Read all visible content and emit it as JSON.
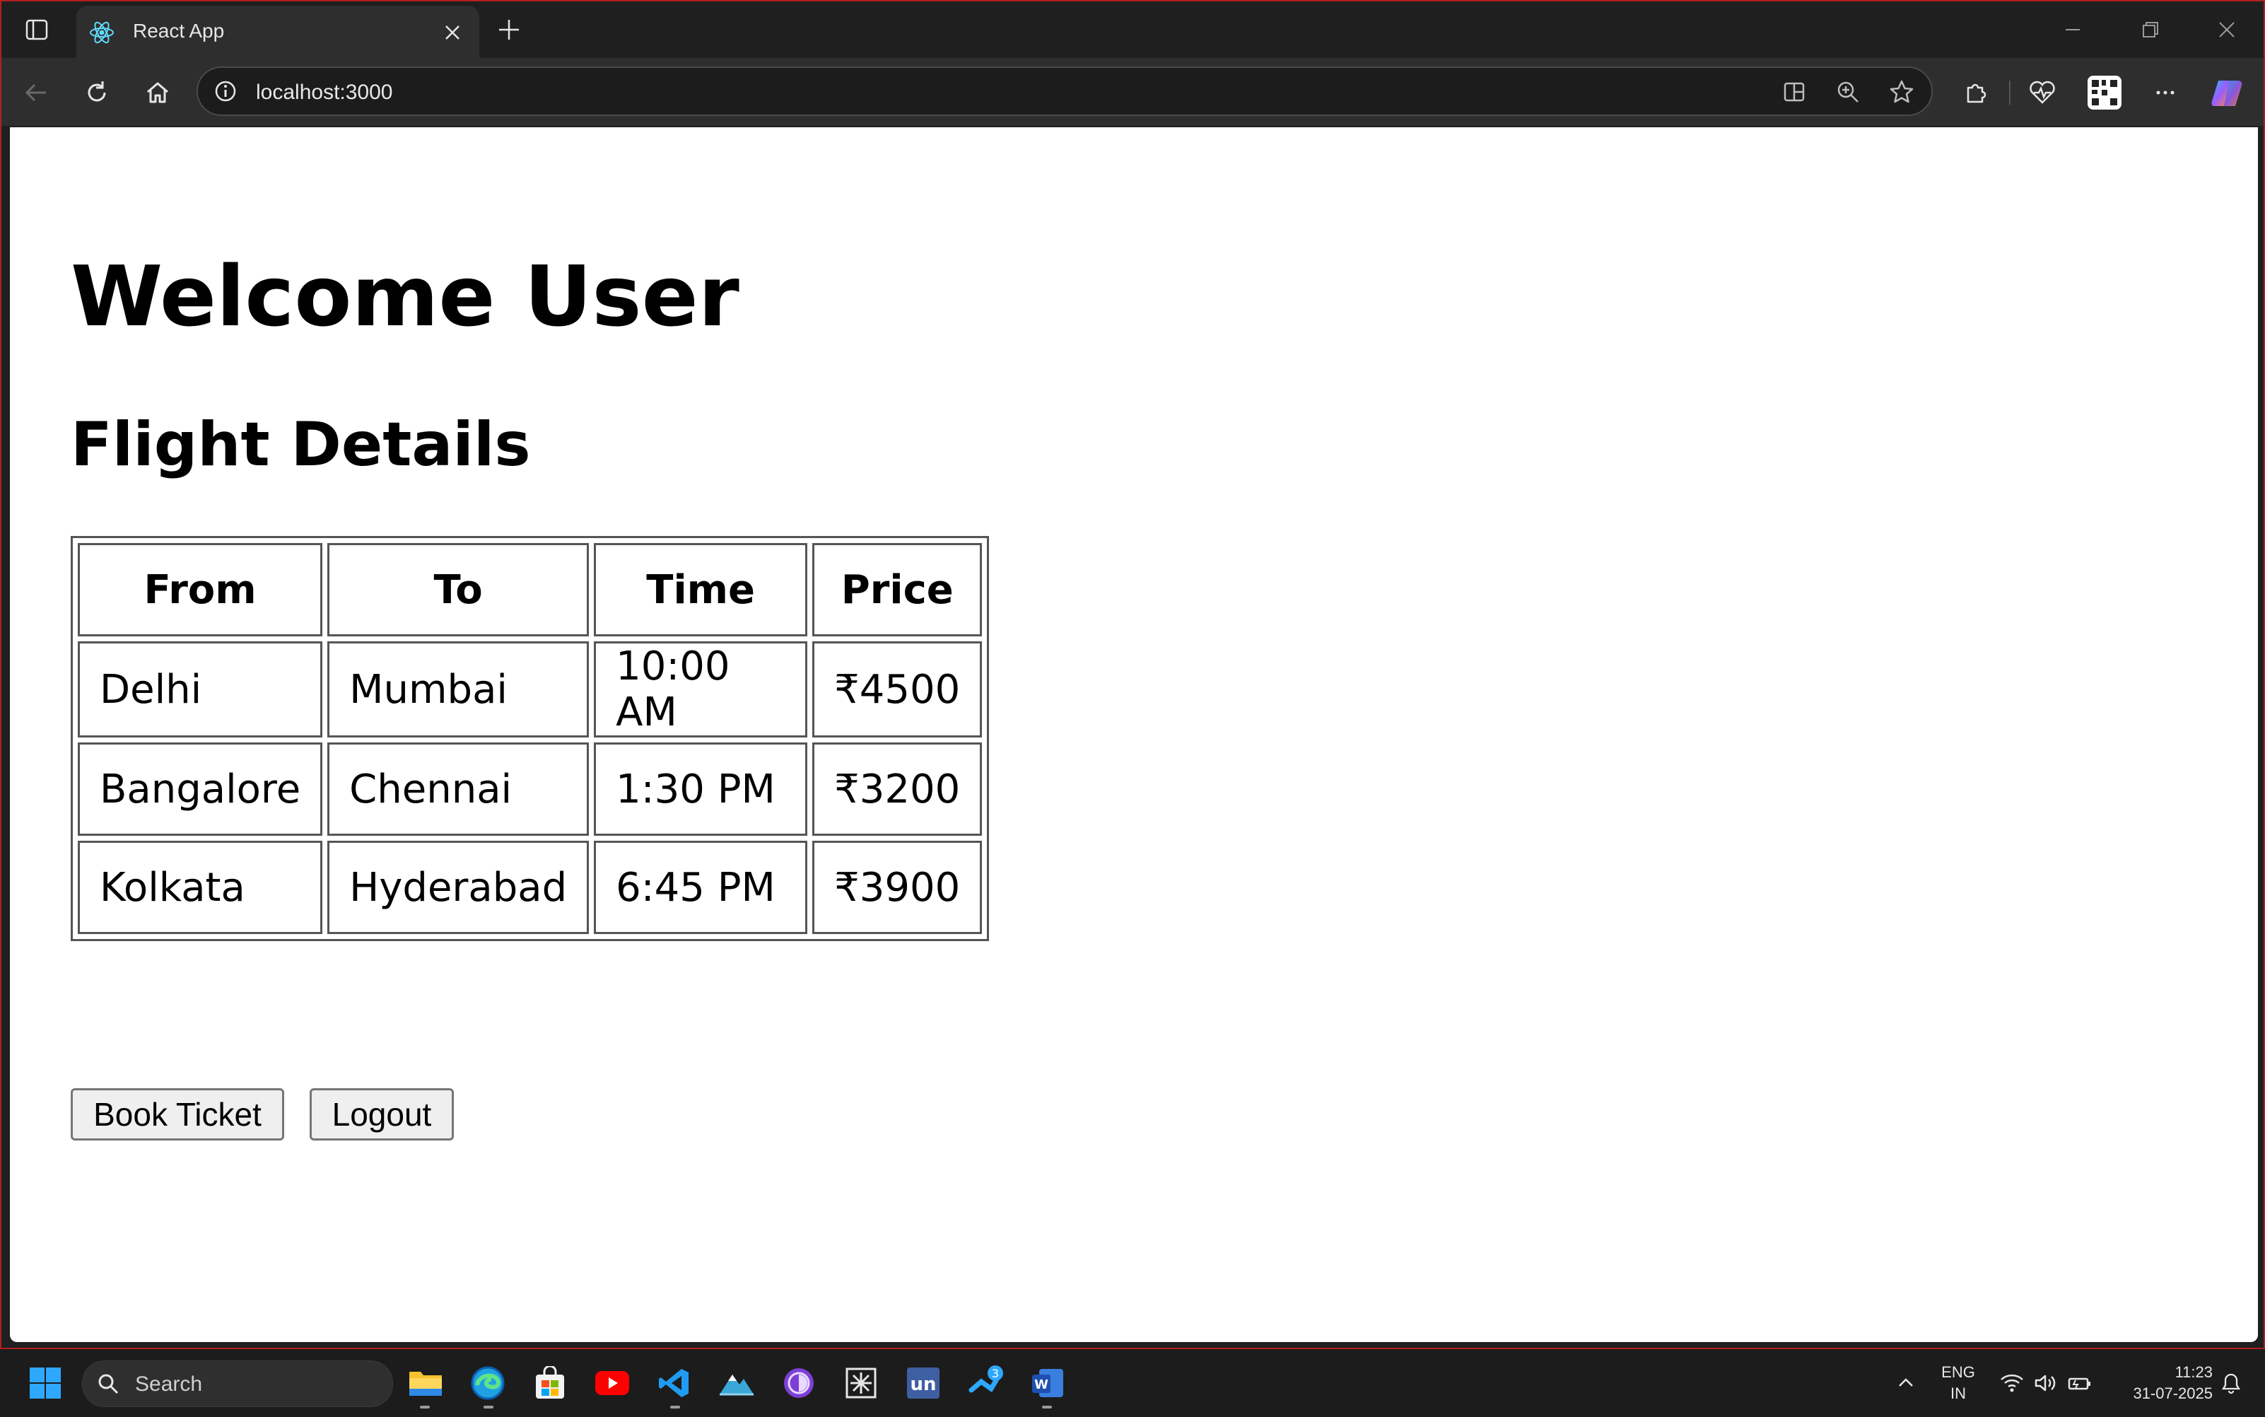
{
  "browser": {
    "tab_title": "React App",
    "url": "localhost:3000"
  },
  "page": {
    "welcome": "Welcome User",
    "flight_heading": "Flight Details",
    "table": {
      "headers": [
        "From",
        "To",
        "Time",
        "Price"
      ],
      "rows": [
        [
          "Delhi",
          "Mumbai",
          "10:00 AM",
          "₹4500"
        ],
        [
          "Bangalore",
          "Chennai",
          "1:30 PM",
          "₹3200"
        ],
        [
          "Kolkata",
          "Hyderabad",
          "6:45 PM",
          "₹3900"
        ]
      ]
    },
    "book_button": "Book Ticket",
    "logout_button": "Logout"
  },
  "taskbar": {
    "search_label": "Search",
    "steam_badge": "3",
    "language": "ENG",
    "region": "IN",
    "time": "11:23",
    "date": "31-07-2025",
    "apps": [
      "file-explorer",
      "edge",
      "microsoft-store",
      "youtube",
      "vscode",
      "app-mountain",
      "tor-browser",
      "snipping-tool",
      "unacademy",
      "steam",
      "word"
    ]
  },
  "colors": {
    "chrome_dark": "#1f1f1f",
    "toolbar": "#2e2e2e",
    "page_background": "#ffffff",
    "window_border": "#b01f1f"
  }
}
